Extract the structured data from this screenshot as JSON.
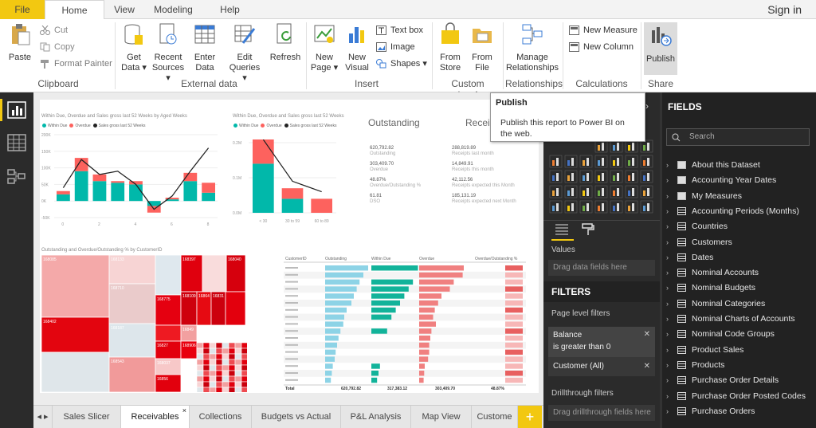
{
  "tabs": {
    "file": "File",
    "home": "Home",
    "view": "View",
    "modeling": "Modeling",
    "help": "Help",
    "signin": "Sign in"
  },
  "ribbon": {
    "paste": "Paste",
    "cut": "Cut",
    "copy": "Copy",
    "format_painter": "Format Painter",
    "clipboard_group": "Clipboard",
    "get_data": "Get",
    "get_data2": "Data",
    "recent": "Recent",
    "recent2": "Sources",
    "enter": "Enter",
    "enter2": "Data",
    "edit": "Edit",
    "edit2": "Queries",
    "refresh": "Refresh",
    "external_group": "External data",
    "new_page": "New",
    "new_page2": "Page",
    "new_visual": "New",
    "new_visual2": "Visual",
    "text_box": "Text box",
    "image": "Image",
    "shapes": "Shapes",
    "insert_group": "Insert",
    "from_store": "From",
    "from_store2": "Store",
    "from_file": "From",
    "from_file2": "File",
    "custom_group": "Custom visuals",
    "manage": "Manage",
    "manage2": "Relationships",
    "relationships_group": "Relationships",
    "new_measure": "New Measure",
    "new_column": "New Column",
    "calc_group": "Calculations",
    "publish": "Publish",
    "share_group": "Share"
  },
  "tooltip": {
    "title": "Publish",
    "body1": "Publish this report to Power BI on",
    "body2": "the web."
  },
  "report": {
    "chart1_title": "Within Due, Overdue and Sales gross last 52 Weeks by Aged Weeks",
    "chart2_title": "Within Due, Overdue and Sales gross last 52 Weeks",
    "legend_within": "Within Due",
    "legend_overdue": "Overdue",
    "legend_sales": "Sales gross last 52 Weeks",
    "outstanding_title": "Outstanding",
    "receipts_title": "Receip",
    "k1": "620,792.82",
    "k1l": "Outstanding",
    "k2": "303,409.70",
    "k2l": "Overdue",
    "k3": "48.87%",
    "k3l": "Overdue/Outstanding %",
    "k4": "61.81",
    "k4l": "DSO",
    "r1": "288,819.89",
    "r1l": "Receipts last month",
    "r2": "14,849.91",
    "r2l": "Receipts this month",
    "r3": "42,112.56",
    "r3l": "Receipts expected this Month",
    "r4": "185,131.19",
    "r4l": "Receipts expected next Month",
    "treemap_title": "Outstanding and Overdue/Outstanding % by CustomerID",
    "tm": [
      "168085",
      "168133",
      "168397",
      "168040",
      "168402",
      "168710",
      "168775",
      "168109",
      "16864",
      "16831",
      "168187",
      "16849",
      "168543",
      "16827",
      "168906",
      "168037",
      "16856",
      "16832"
    ],
    "table_headers": [
      "CustomerID",
      "Outstanding",
      "Within Due",
      "Overdue",
      "Overdue/Outstanding %"
    ],
    "table_total": [
      "Total",
      "620,792.82",
      "317,383.12",
      "303,409.70",
      "48.87%"
    ]
  },
  "chart_data": [
    {
      "type": "bar",
      "categories": [
        "0",
        "2",
        "4",
        "6",
        "8"
      ],
      "series": [
        {
          "name": "Within Due",
          "values": [
            20,
            90,
            60,
            55,
            50,
            -15,
            5,
            60,
            25
          ]
        },
        {
          "name": "Overdue",
          "values": [
            10,
            40,
            20,
            5,
            10,
            -20,
            5,
            25,
            30
          ]
        },
        {
          "name": "Sales gross last 52 Weeks",
          "values": [
            40,
            125,
            80,
            90,
            50,
            -25,
            15,
            90,
            160
          ]
        }
      ],
      "ylim": [
        -50,
        200
      ]
    },
    {
      "type": "bar",
      "categories": [
        "< 30",
        "30 to 59",
        "60 to 89"
      ],
      "series": [
        {
          "name": "Within Due",
          "values": [
            0.14,
            0.04,
            0
          ]
        },
        {
          "name": "Overdue",
          "values": [
            0.07,
            0.03,
            0.04
          ]
        }
      ],
      "ylim": [
        0,
        0.2
      ]
    }
  ],
  "tooltip_pub": "",
  "viz": {
    "values_label": "Values",
    "drag_fields": "Drag data fields here",
    "filters_title": "FILTERS",
    "page_filters": "Page level filters",
    "f1_title": "Balance",
    "f1_value": "is greater than 0",
    "f2": "Customer  (All)",
    "drillthrough": "Drillthrough filters",
    "drag_drill": "Drag drillthrough fields here"
  },
  "fields": {
    "title": "FIELDS",
    "search": "Search",
    "items": [
      "About this Dataset",
      "Accounting Year Dates",
      "My Measures",
      "Accounting Periods (Months)",
      "Countries",
      "Customers",
      "Dates",
      "Nominal Accounts",
      "Nominal Budgets",
      "Nominal Categories",
      "Nominal Charts of Accounts",
      "Nominal Code Groups",
      "Product Sales",
      "Products",
      "Purchase Order Details",
      "Purchase Order Posted Codes",
      "Purchase Orders"
    ]
  },
  "pages": [
    "Sales Slicer",
    "Receivables",
    "Collections",
    "Budgets vs Actual",
    "P&L Analysis",
    "Map View",
    "Custome"
  ]
}
